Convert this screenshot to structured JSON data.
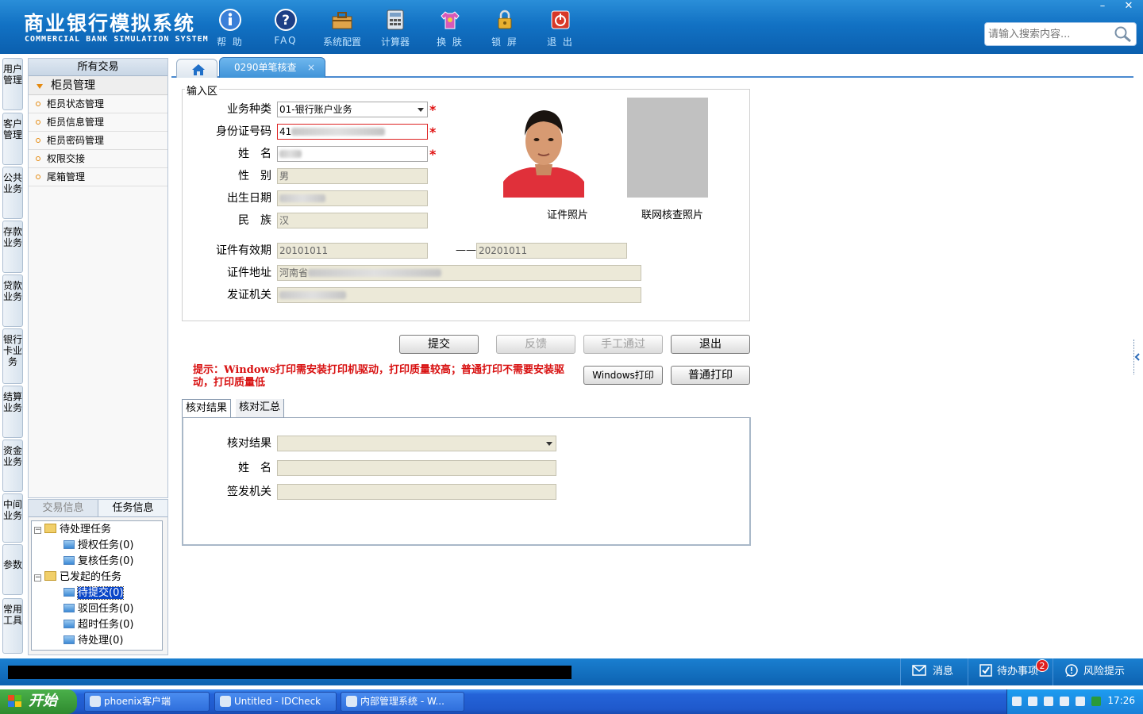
{
  "app": {
    "title_cn": "商业银行模拟系统",
    "title_en": "COMMERCIAL BANK SIMULATION SYSTEM"
  },
  "toolbar": [
    {
      "label": "帮 助",
      "icon": "info-icon"
    },
    {
      "label": "FAQ",
      "icon": "question-icon"
    },
    {
      "label": "系统配置",
      "icon": "toolbox-icon"
    },
    {
      "label": "计算器",
      "icon": "calculator-icon"
    },
    {
      "label": "换 肤",
      "icon": "tshirt-icon"
    },
    {
      "label": "锁 屏",
      "icon": "lock-icon"
    },
    {
      "label": "退 出",
      "icon": "power-icon"
    }
  ],
  "search": {
    "placeholder": "请输入搜索内容..."
  },
  "window": {
    "minimize": "–",
    "close": "✕"
  },
  "vtabs": [
    "用户管理",
    "客户管理",
    "公共业务",
    "存款业务",
    "贷款业务",
    "银行卡业务",
    "结算业务",
    "资金业务",
    "中间业务",
    "参数",
    "常用工具"
  ],
  "nav": {
    "title": "所有交易",
    "group": "柜员管理",
    "items": [
      "柜员状态管理",
      "柜员信息管理",
      "柜员密码管理",
      "权限交接",
      "尾箱管理"
    ]
  },
  "task_panel": {
    "tabs": [
      "交易信息",
      "任务信息"
    ],
    "tree": {
      "pending": "待处理任务",
      "auth": "授权任务(0)",
      "review": "复核任务(0)",
      "initiated": "已发起的任务",
      "to_submit": "待提交(0)",
      "rejected": "驳回任务(0)",
      "timeout": "超时任务(0)",
      "to_process": "待处理(0)"
    }
  },
  "tabs": {
    "active": "0290单笔核查",
    "close": "×"
  },
  "form": {
    "legend": "输入区",
    "biz_type_label": "业务种类",
    "biz_type_value": "01-银行账户业务",
    "id_label": "身份证号码",
    "id_value": "41",
    "name_label": "姓　名",
    "gender_label": "性　别",
    "gender_value": "男",
    "dob_label": "出生日期",
    "ethnic_label": "民　族",
    "ethnic_value": "汉",
    "validity_label": "证件有效期",
    "validity_start": "20101011",
    "validity_sep": "——",
    "validity_end": "20201011",
    "address_label": "证件地址",
    "address_value": "河南省",
    "issuer_label": "发证机关",
    "required_mark": "*",
    "photo_id_caption": "证件照片",
    "photo_net_caption": "联网核查照片"
  },
  "buttons": {
    "submit": "提交",
    "feedback": "反馈",
    "manual_pass": "手工通过",
    "exit": "退出",
    "win_print": "Windows打印",
    "normal_print": "普通打印"
  },
  "tip": "提示：Windows打印需安装打印机驱动，打印质量较高；普通打印不需要安装驱动，打印质量低",
  "result": {
    "tabs": [
      "核对结果",
      "核对汇总"
    ],
    "result_label": "核对结果",
    "name_label": "姓　名",
    "issuer_label": "签发机关"
  },
  "statusbar": {
    "message": "消息",
    "todo": "待办事项",
    "todo_count": "2",
    "risk": "风险提示"
  },
  "taskbar": {
    "start": "开始",
    "items": [
      "phoenix客户端",
      "Untitled - IDCheck",
      "内部管理系统 - W..."
    ],
    "clock": "17:26"
  },
  "colors": {
    "banner": "#1272c4",
    "accent_orange": "#e58a10",
    "required_red": "#e01010",
    "readonly_field": "#ece9d8"
  }
}
